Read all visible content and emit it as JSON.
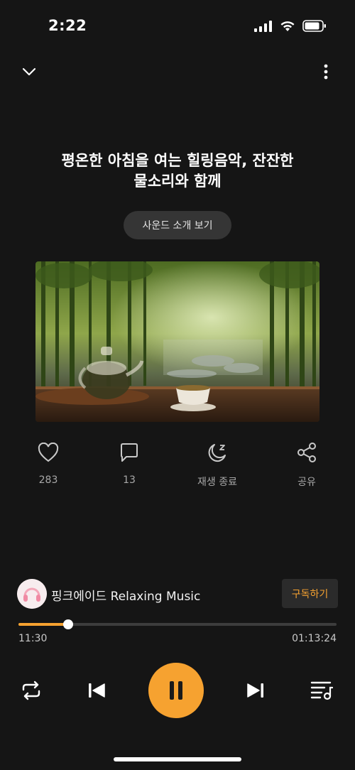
{
  "status": {
    "time": "2:22",
    "icons": [
      "cellular-signal-icon",
      "wifi-icon",
      "battery-icon"
    ]
  },
  "header": {
    "collapse_icon": "chevron-down-icon",
    "more_icon": "more-vertical-icon"
  },
  "track": {
    "title_line1": "평온한 아침을 여는 힐링음악, 잔잔한",
    "title_line2": "물소리와 함께",
    "intro_button": "사운드 소개 보기"
  },
  "actions": [
    {
      "icon": "heart-icon",
      "label": "283"
    },
    {
      "icon": "comment-icon",
      "label": "13"
    },
    {
      "icon": "sleep-timer-moon-icon",
      "label": "재생 종료"
    },
    {
      "icon": "share-icon",
      "label": "공유"
    }
  ],
  "channel": {
    "name": "핑크에이드 Relaxing Music",
    "subscribe_label": "구독하기"
  },
  "playback": {
    "current_time": "11:30",
    "total_time": "01:13:24",
    "progress_fraction": 0.157
  },
  "controls": {
    "repeat_icon": "repeat-icon",
    "prev_icon": "skip-previous-icon",
    "play_pause_icon": "pause-icon",
    "next_icon": "skip-next-icon",
    "playlist_icon": "playlist-icon",
    "accent_color": "#f6a230"
  }
}
